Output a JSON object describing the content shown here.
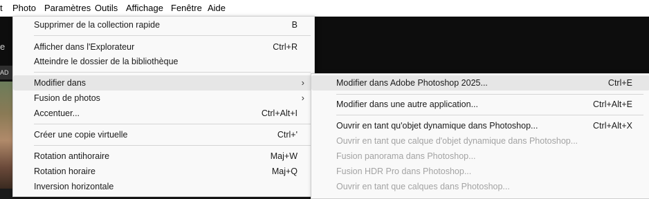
{
  "menubar": {
    "items": [
      "t",
      "Photo",
      "Paramètres",
      "Outils",
      "Affichage",
      "Fenêtre",
      "Aide"
    ]
  },
  "background": {
    "side_text": "e",
    "strip_text": "AD"
  },
  "photo_menu": {
    "items": [
      {
        "label": "Supprimer de la collection rapide",
        "shortcut": "B"
      },
      {
        "label": "Afficher dans l'Explorateur",
        "shortcut": "Ctrl+R"
      },
      {
        "label": "Atteindre le dossier de la bibliothèque",
        "shortcut": ""
      },
      {
        "label": "Modifier dans",
        "shortcut": "",
        "submenu": true
      },
      {
        "label": "Fusion de photos",
        "shortcut": "",
        "submenu": true
      },
      {
        "label": "Accentuer...",
        "shortcut": "Ctrl+Alt+I"
      },
      {
        "label": "Créer une copie virtuelle",
        "shortcut": "Ctrl+'"
      },
      {
        "label": "Rotation antihoraire",
        "shortcut": "Maj+W"
      },
      {
        "label": "Rotation horaire",
        "shortcut": "Maj+Q"
      },
      {
        "label": "Inversion horizontale",
        "shortcut": ""
      }
    ],
    "arrow_glyph": "›"
  },
  "modifier_submenu": {
    "items": [
      {
        "label": "Modifier dans Adobe Photoshop 2025...",
        "shortcut": "Ctrl+E",
        "enabled": true
      },
      {
        "label": "Modifier dans une autre application...",
        "shortcut": "Ctrl+Alt+E",
        "enabled": true
      },
      {
        "label": "Ouvrir en tant qu'objet dynamique dans Photoshop...",
        "shortcut": "Ctrl+Alt+X",
        "enabled": true
      },
      {
        "label": "Ouvrir en tant que calque d'objet dynamique dans Photoshop...",
        "shortcut": "",
        "enabled": false
      },
      {
        "label": "Fusion panorama dans Photoshop...",
        "shortcut": "",
        "enabled": false
      },
      {
        "label": "Fusion HDR Pro dans Photoshop...",
        "shortcut": "",
        "enabled": false
      },
      {
        "label": "Ouvrir en tant que calques dans Photoshop...",
        "shortcut": "",
        "enabled": false
      }
    ]
  },
  "colors": {
    "menu_bg": "#f9f9f9",
    "highlight": "#e6e6e6",
    "disabled_text": "#a3a3a3",
    "app_bg": "#0d0d0d"
  }
}
